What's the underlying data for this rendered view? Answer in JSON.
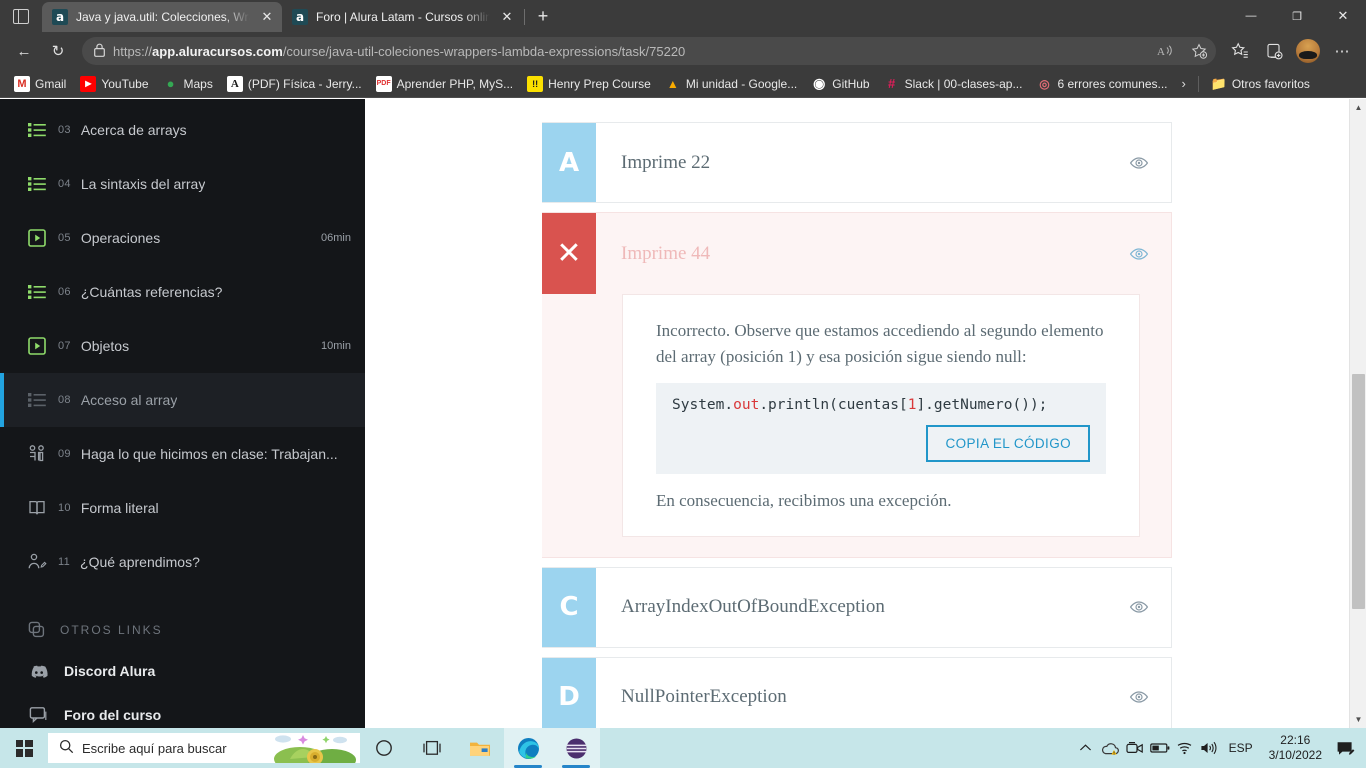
{
  "browser": {
    "tab_list_icon": "tab-list-icon",
    "tabs": [
      {
        "favicon_letter": "a",
        "title": "Java y java.util: Colecciones, Wra",
        "close": "✕"
      },
      {
        "favicon_letter": "a",
        "title": "Foro | Alura Latam - Cursos onlin",
        "close": "✕"
      }
    ],
    "new_tab_label": "+",
    "window_controls": {
      "minimize": "—",
      "maximize": "❐",
      "close": "✕"
    },
    "toolbar": {
      "back": "←",
      "reload": "↻",
      "lock_icon": "lock-icon",
      "url_prefix": "https://",
      "url_host": "app.aluracursos.com",
      "url_path": "/course/java-util-coleciones-wrappers-lambda-expressions/task/75220",
      "read_aloud": "Aᴰ",
      "add_favorite": "☆",
      "favorites_hub": "☆",
      "collections": "⧉",
      "profile": "avatar",
      "settings_more": "⋯"
    },
    "bookmarks": [
      {
        "label": "Gmail",
        "icon": "M",
        "icon_bg": "#ffffff",
        "icon_fg": "#d93025"
      },
      {
        "label": "YouTube",
        "icon": "▶",
        "icon_bg": "#ff0000",
        "icon_fg": "#ffffff"
      },
      {
        "label": "Maps",
        "icon": "◉",
        "icon_bg": "transparent",
        "icon_fg": "#34a853"
      },
      {
        "label": "(PDF) Física - Jerry...",
        "icon": "A",
        "icon_bg": "#ffffff",
        "icon_fg": "#1a1a1a"
      },
      {
        "label": "Aprender PHP, MyS...",
        "icon": "P",
        "icon_bg": "#ffffff",
        "icon_fg": "#e02f2f"
      },
      {
        "label": "Henry Prep Course",
        "icon": "!!",
        "icon_bg": "#fbe000",
        "icon_fg": "#1a1a1a"
      },
      {
        "label": "Mi unidad - Google...",
        "icon": "▲",
        "icon_bg": "transparent",
        "icon_fg": "#f9ab00"
      },
      {
        "label": "GitHub",
        "icon": "●",
        "icon_bg": "transparent",
        "icon_fg": "#ffffff"
      },
      {
        "label": "Slack | 00-clases-ap...",
        "icon": "#",
        "icon_bg": "transparent",
        "icon_fg": "#e01e5a"
      },
      {
        "label": "6 errores comunes...",
        "icon": "◎",
        "icon_bg": "transparent",
        "icon_fg": "#e06c75"
      }
    ],
    "bookmarks_overflow": "›",
    "other_favorites": {
      "label": "Otros favoritos",
      "icon": "📁"
    }
  },
  "sidebar": {
    "items": [
      {
        "num": "03",
        "label": "Acerca de arrays",
        "icon": "list-icon",
        "duration": "",
        "active": false
      },
      {
        "num": "04",
        "label": "La sintaxis del array",
        "icon": "list-icon",
        "duration": "",
        "active": false
      },
      {
        "num": "05",
        "label": "Operaciones",
        "icon": "video-icon",
        "duration": "06min",
        "active": false
      },
      {
        "num": "06",
        "label": "¿Cuántas referencias?",
        "icon": "list-icon",
        "duration": "",
        "active": false
      },
      {
        "num": "07",
        "label": "Objetos",
        "icon": "video-icon",
        "duration": "10min",
        "active": false
      },
      {
        "num": "08",
        "label": "Acceso al array",
        "icon": "list-icon",
        "duration": "",
        "active": true
      },
      {
        "num": "09",
        "label": "Haga lo que hicimos en clase: Trabajan...",
        "icon": "people-icon",
        "duration": "",
        "active": false
      },
      {
        "num": "10",
        "label": "Forma literal",
        "icon": "book-icon",
        "duration": "",
        "active": false
      },
      {
        "num": "11",
        "label": "¿Qué aprendimos?",
        "icon": "user-edit-icon",
        "duration": "",
        "active": false
      }
    ],
    "other_links_header": {
      "label": "OTROS LINKS",
      "icon": "link-icon"
    },
    "links": [
      {
        "label": "Discord Alura",
        "icon": "discord-icon"
      },
      {
        "label": "Foro del curso",
        "icon": "forum-icon"
      }
    ],
    "accent_color": "#22a3e0"
  },
  "quiz": {
    "options": [
      {
        "badge": "A",
        "text": "Imprime 22",
        "state": "normal",
        "badge_color": "#9cd4ef"
      },
      {
        "badge": "✕",
        "text": "Imprime 44",
        "state": "wrong",
        "badge_color": "#d9534f"
      },
      {
        "badge": "C",
        "text": "ArrayIndexOutOfBoundException",
        "state": "normal",
        "badge_color": "#9cd4ef"
      },
      {
        "badge": "D",
        "text": "NullPointerException",
        "state": "normal",
        "badge_color": "#9cd4ef"
      }
    ],
    "eye_icon": "eye-icon",
    "feedback": {
      "intro": "Incorrecto. Observe que estamos accediendo al segundo elemento del array (posición 1) y esa posición sigue siendo null:",
      "code": {
        "part1": "System.",
        "keyword": "out",
        "part2": ".println(cuentas[",
        "number": "1",
        "part3": "].getNumero());"
      },
      "copy_button": "COPIA EL CÓDIGO",
      "outro": "En consecuencia, recibimos una excepción."
    }
  },
  "scrollbar": {
    "up_arrow": "▲",
    "down_arrow": "▼"
  },
  "taskbar": {
    "start_label": "start-button",
    "search_placeholder": "Escribe aquí para buscar",
    "search_icon": "🔍",
    "tasks": [
      {
        "name": "cortana-icon",
        "glyph": "○",
        "open": false
      },
      {
        "name": "task-view-icon",
        "glyph": "⌸",
        "open": false
      },
      {
        "name": "file-explorer-icon",
        "glyph": "🗂",
        "open": false
      },
      {
        "name": "edge-icon",
        "glyph": "◔",
        "open": true
      },
      {
        "name": "app-icon",
        "glyph": "●",
        "open": true
      }
    ],
    "tray": {
      "chevron": "⌃",
      "onedrive": "☁",
      "meet_now": "📷",
      "battery": "▭",
      "wifi": "◠",
      "volume": "🔊",
      "language": "ESP",
      "time": "22:16",
      "date": "3/10/2022",
      "action_center": "🗒"
    }
  }
}
